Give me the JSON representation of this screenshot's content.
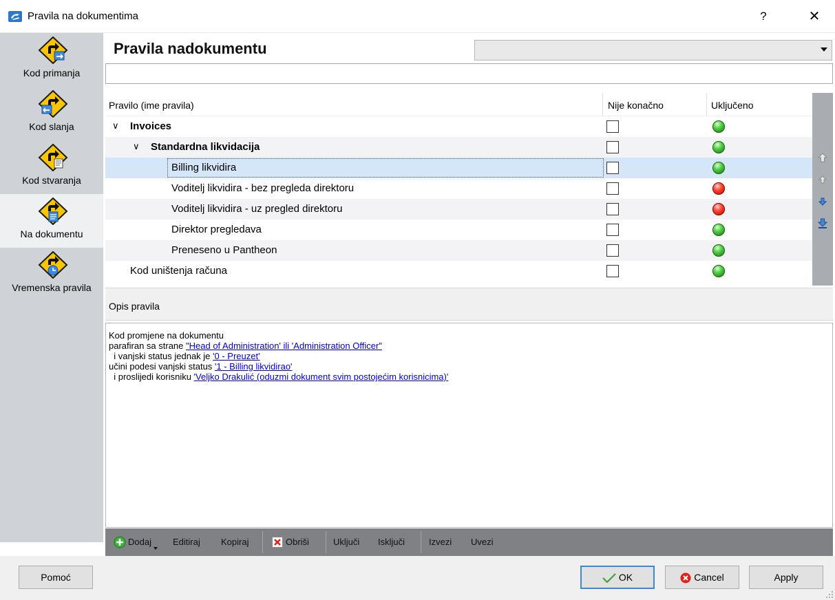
{
  "window": {
    "title": "Pravila na dokumentima",
    "help_label": "?",
    "close_label": "✕"
  },
  "sidebar": {
    "items": [
      {
        "label": "Kod primanja",
        "icon": "incoming-rule-icon",
        "active": false
      },
      {
        "label": "Kod slanja",
        "icon": "outgoing-rule-icon",
        "active": false
      },
      {
        "label": "Kod stvaranja",
        "icon": "create-rule-icon",
        "active": false
      },
      {
        "label": "Na dokumentu",
        "icon": "document-rule-icon",
        "active": true
      },
      {
        "label": "Vremenska pravila",
        "icon": "timed-rule-icon",
        "active": false
      }
    ]
  },
  "header": {
    "title": "Pravila nadokumentu",
    "select_value": "",
    "search_value": ""
  },
  "table": {
    "columns": [
      "Pravilo (ime pravila)",
      "Nije konačno",
      "Uključeno"
    ],
    "rows": [
      {
        "label": "Invoices",
        "level": 0,
        "bold": true,
        "expandable": true,
        "nije_konacno": false,
        "status": "green"
      },
      {
        "label": "Standardna likvidacija",
        "level": 1,
        "bold": true,
        "expandable": true,
        "nije_konacno": false,
        "status": "green"
      },
      {
        "label": "Billing likvidira",
        "level": 2,
        "bold": false,
        "expandable": false,
        "nije_konacno": false,
        "status": "green",
        "selected": true
      },
      {
        "label": "Voditelj likvidira - bez pregleda direktoru",
        "level": 2,
        "bold": false,
        "expandable": false,
        "nije_konacno": false,
        "status": "red"
      },
      {
        "label": "Voditelj likvidira - uz pregled direktoru",
        "level": 2,
        "bold": false,
        "expandable": false,
        "nije_konacno": false,
        "status": "red"
      },
      {
        "label": "Direktor pregledava",
        "level": 2,
        "bold": false,
        "expandable": false,
        "nije_konacno": false,
        "status": "green"
      },
      {
        "label": "Preneseno u Pantheon",
        "level": 2,
        "bold": false,
        "expandable": false,
        "nije_konacno": false,
        "status": "green"
      },
      {
        "label": "Kod uništenja računa",
        "level": 0,
        "bold": false,
        "expandable": false,
        "nije_konacno": false,
        "status": "green"
      }
    ]
  },
  "description": {
    "label": "Opis pravila",
    "lines": [
      {
        "text": "Kod promjene na dokumentu",
        "link": ""
      },
      {
        "text": "parafiran sa strane ",
        "link": "\"Head of Administration' ili 'Administration Officer\""
      },
      {
        "text": "  i vanjski status jednak je ",
        "link": "'0 - Preuzet'"
      },
      {
        "text": "učini podesi vanjski status ",
        "link": "'1 - Billing likvidirao'"
      },
      {
        "text": "  i proslijedi korisniku ",
        "link": "'Veljko Drakulić (oduzmi dokument svim postojećim korisnicima)'"
      }
    ]
  },
  "toolbar": {
    "add_label": "Dodaj",
    "edit_label": "Editiraj",
    "copy_label": "Kopiraj",
    "delete_label": "Obriši",
    "enable_label": "Uključi",
    "disable_label": "Isključi",
    "export_label": "Izvezi",
    "import_label": "Uvezi"
  },
  "footer": {
    "help_label": "Pomoć",
    "ok_label": "OK",
    "cancel_label": "Cancel",
    "apply_label": "Apply"
  },
  "colors": {
    "sidebar_bg": "#cfd2d6",
    "selected_row": "#d4e6f8",
    "link": "#0000d8",
    "status_green": "#2aa823",
    "status_red": "#e01b0b"
  }
}
